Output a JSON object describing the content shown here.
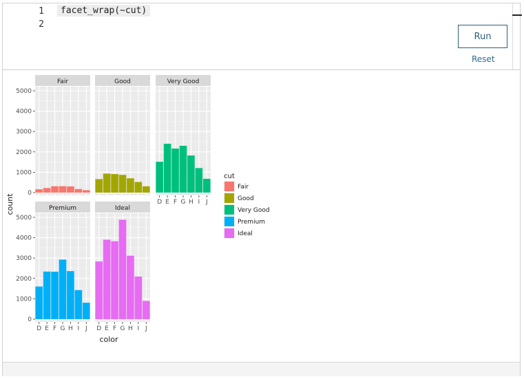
{
  "editor": {
    "line_numbers": [
      "1",
      "2"
    ],
    "code": "facet_wrap(~cut)"
  },
  "controls": {
    "run_label": "Run",
    "reset_label": "Reset"
  },
  "chart_data": {
    "type": "bar",
    "facet_by": "cut",
    "categories": [
      "D",
      "E",
      "F",
      "G",
      "H",
      "I",
      "J"
    ],
    "xlabel": "color",
    "ylabel": "count",
    "ylim": [
      0,
      5000
    ],
    "yticks": [
      0,
      1000,
      2000,
      3000,
      4000,
      5000
    ],
    "grid": true,
    "legend_title": "cut",
    "legend_position": "right",
    "series": [
      {
        "name": "Fair",
        "color": "#F8766D",
        "values": [
          163,
          224,
          312,
          314,
          303,
          175,
          119
        ]
      },
      {
        "name": "Good",
        "color": "#A3A500",
        "values": [
          662,
          933,
          909,
          871,
          702,
          522,
          307
        ]
      },
      {
        "name": "Very Good",
        "color": "#00BF7D",
        "values": [
          1513,
          2400,
          2164,
          2299,
          1824,
          1204,
          678
        ]
      },
      {
        "name": "Premium",
        "color": "#00B0F6",
        "values": [
          1603,
          2337,
          2331,
          2924,
          2360,
          1428,
          808
        ]
      },
      {
        "name": "Ideal",
        "color": "#E76BF3",
        "values": [
          2834,
          3903,
          3826,
          4884,
          3115,
          2093,
          896
        ]
      }
    ]
  }
}
